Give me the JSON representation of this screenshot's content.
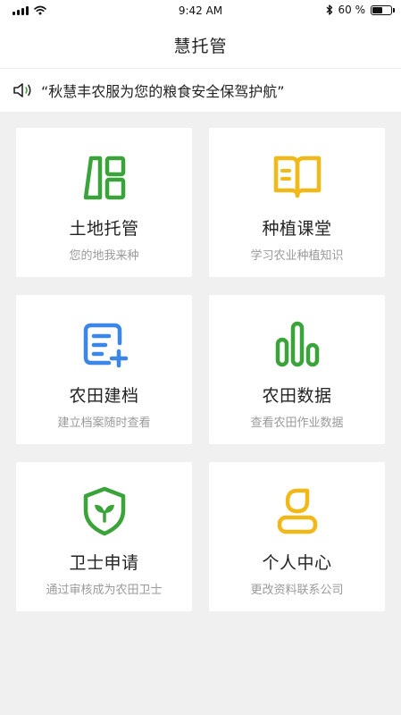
{
  "status_bar": {
    "time": "9:42 AM",
    "battery_percent": "60 %",
    "battery_level": 0.6,
    "icons": [
      "signal-icon",
      "wifi-icon",
      "bluetooth-icon",
      "battery-icon"
    ]
  },
  "header": {
    "title": "慧托管"
  },
  "notice": {
    "text": "“秋慧丰农服为您的粮食安全保驾护航”",
    "icon": "speaker-icon"
  },
  "colors": {
    "green": "#3aa43a",
    "yellow": "#f2b817",
    "blue": "#3b86e6",
    "subtitle": "#9a9a9a"
  },
  "cards": [
    {
      "title": "土地托管",
      "subtitle": "您的地我来种",
      "icon": "land-layout-icon",
      "color": "#3aa43a"
    },
    {
      "title": "种植课堂",
      "subtitle": "学习农业种植知识",
      "icon": "open-book-icon",
      "color": "#f2b817"
    },
    {
      "title": "农田建档",
      "subtitle": "建立档案随时查看",
      "icon": "document-add-icon",
      "color": "#3b86e6"
    },
    {
      "title": "农田数据",
      "subtitle": "查看农田作业数据",
      "icon": "bar-chart-icon",
      "color": "#3aa43a"
    },
    {
      "title": "卫士申请",
      "subtitle": "通过审核成为农田卫士",
      "icon": "shield-sprout-icon",
      "color": "#3aa43a"
    },
    {
      "title": "个人中心",
      "subtitle": "更改资料联系公司",
      "icon": "user-icon",
      "color": "#f2b817"
    }
  ]
}
